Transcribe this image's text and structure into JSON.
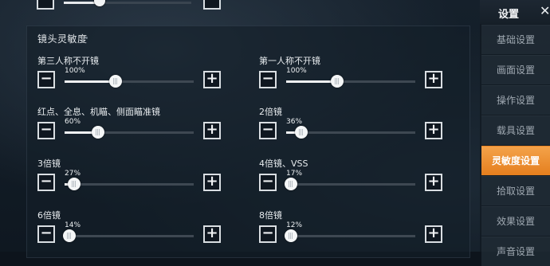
{
  "sidebar": {
    "title": "设置",
    "close": "✕",
    "items": [
      {
        "label": "基础设置",
        "active": false
      },
      {
        "label": "画面设置",
        "active": false
      },
      {
        "label": "操作设置",
        "active": false
      },
      {
        "label": "载具设置",
        "active": false
      },
      {
        "label": "灵敏度设置",
        "active": true
      },
      {
        "label": "拾取设置",
        "active": false
      },
      {
        "label": "效果设置",
        "active": false
      },
      {
        "label": "声音设置",
        "active": false
      }
    ]
  },
  "section": {
    "title": "镜头灵敏度"
  },
  "top_slider": {
    "percent": 28
  },
  "settings": [
    {
      "label": "第三人称不开镜",
      "value": "100%",
      "percent": 36
    },
    {
      "label": "第一人称不开镜",
      "value": "100%",
      "percent": 36
    },
    {
      "label": "红点、全息、机瞄、侧面瞄准镜",
      "value": "60%",
      "percent": 22
    },
    {
      "label": "2倍镜",
      "value": "36%",
      "percent": 8
    },
    {
      "label": "3倍镜",
      "value": "27%",
      "percent": 4
    },
    {
      "label": "4倍镜、VSS",
      "value": "17%",
      "percent": 0
    },
    {
      "label": "6倍镜",
      "value": "14%",
      "percent": 0
    },
    {
      "label": "8倍镜",
      "value": "12%",
      "percent": 0
    }
  ],
  "controls": {
    "minus": "−",
    "plus": "+"
  },
  "colors": {
    "accent": "#f08f2e",
    "thumb": "#f4f6f7",
    "track": "#3e4852"
  }
}
